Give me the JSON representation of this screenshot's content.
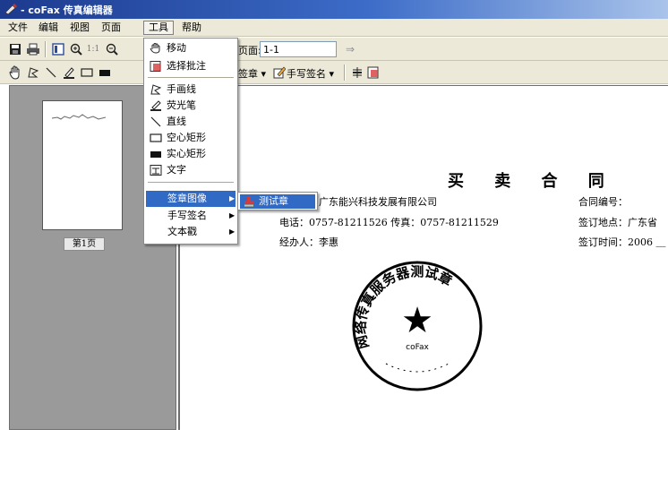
{
  "window": {
    "title": "- coFax 传真编辑器",
    "icon": "cofax-app-icon"
  },
  "menubar": {
    "items": [
      {
        "label": "文件"
      },
      {
        "label": "编辑"
      },
      {
        "label": "视图"
      },
      {
        "label": "页面"
      },
      {
        "label": "工具"
      },
      {
        "label": "帮助"
      }
    ],
    "open_menu": "工具"
  },
  "toolbar1": {
    "buttons": [
      "save-icon",
      "print-icon",
      "thumbnail-icon",
      "zoom-in-icon",
      "actual-size-icon",
      "zoom-out-icon"
    ],
    "actual_size_label": "1:1",
    "page_label": "页面:",
    "page_value": "1-1",
    "go_arrow": "⇒"
  },
  "toolbar2": {
    "buttons": [
      "hand-icon",
      "freehand-icon",
      "line-icon",
      "highlighter-icon",
      "hollow-rect-icon",
      "solid-rect-icon"
    ],
    "stamp_label": "签章",
    "signature_label": "手写签名",
    "dropdown_arrow": "▾"
  },
  "thumbnails": {
    "page_label": "第1页"
  },
  "tools_menu": {
    "items": [
      {
        "label": "移动",
        "icon": "hand-icon"
      },
      {
        "label": "选择批注",
        "icon": "select-annotation-icon"
      },
      {
        "label": "手画线",
        "icon": "freehand-icon"
      },
      {
        "label": "荧光笔",
        "icon": "highlighter-icon"
      },
      {
        "label": "直线",
        "icon": "line-icon"
      },
      {
        "label": "空心矩形",
        "icon": "hollow-rect-icon"
      },
      {
        "label": "实心矩形",
        "icon": "solid-rect-icon"
      },
      {
        "label": "文字",
        "icon": "text-icon"
      },
      {
        "label": "签章图像",
        "submenu": true
      },
      {
        "label": "手写签名",
        "submenu": true
      },
      {
        "label": "文本戳",
        "submenu": true
      }
    ],
    "highlighted": "签章图像",
    "submenu_arrow": "▶"
  },
  "stamp_submenu": {
    "items": [
      {
        "label": "测试章",
        "icon": "stamp-icon"
      }
    ]
  },
  "document": {
    "title": "买 卖 合 同",
    "seller_company": "广东能兴科技发展有限公司",
    "phone_line": "电话：0757-81211526  传真：0757-81211529",
    "agent_line": "经办人：李惠",
    "contract_no": "合同编号：",
    "sign_place": "签订地点：广东省",
    "sign_time": "签订时间：2006 ＿",
    "stamp": {
      "ring_text": "网络传真服务器测试章",
      "center_text": "coFax",
      "star": "★"
    }
  },
  "colors": {
    "menu_highlight": "#316ac5",
    "chrome": "#ece9d8",
    "thumb_panel": "#9a9a9a",
    "titlebar": "#1c3a8e"
  }
}
